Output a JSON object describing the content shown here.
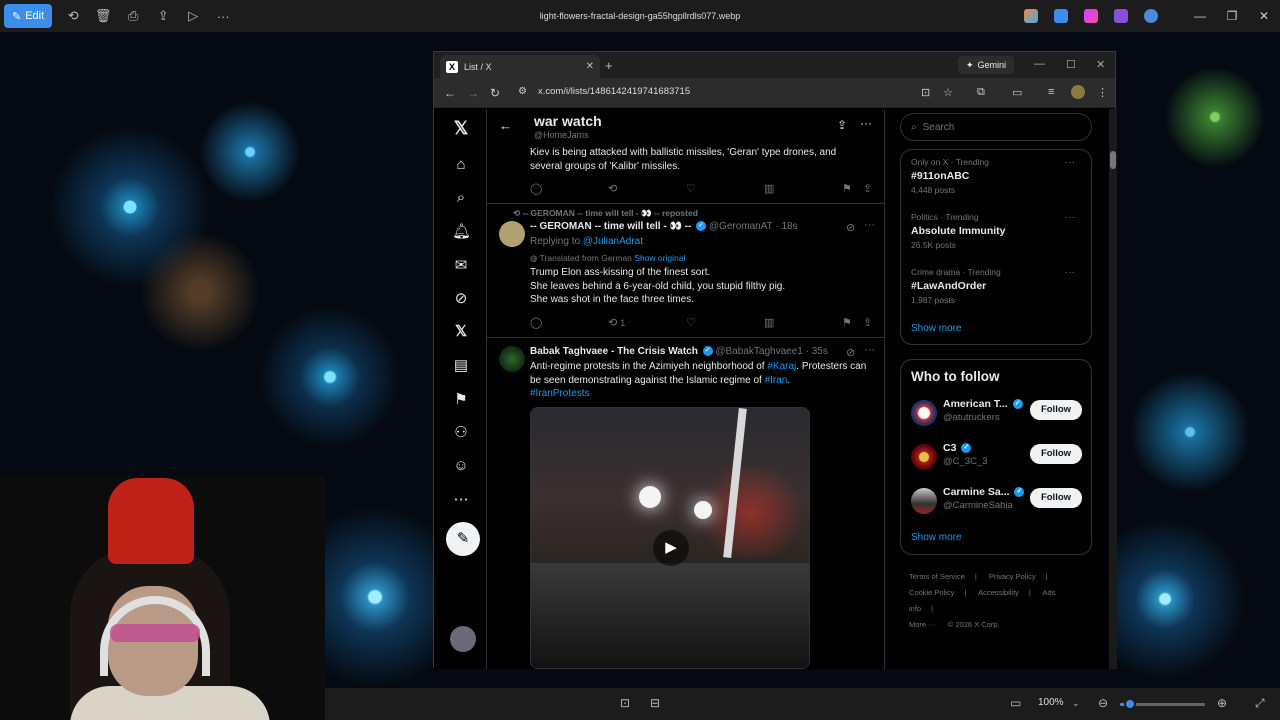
{
  "viewer": {
    "edit_label": "Edit",
    "filename": "light-flowers-fractal-design-ga55hgpllrdls077.webp",
    "zoom": "100%",
    "zoom_level": 0.12
  },
  "browser": {
    "tab_title": "List / X",
    "tab_logo": "X",
    "new_tab": "+",
    "gemini_label": "Gemini",
    "url": "x.com/i/lists/1486142419741683715"
  },
  "list": {
    "title": "war watch",
    "handle": "@HomeJams"
  },
  "tweets": [
    {
      "text": "Kiev is being attacked with ballistic missiles, 'Geran' type drones, and several groups of 'Kalibr' missiles.",
      "retweets": "",
      "likes": ""
    },
    {
      "repost_label": "-- GEROMAN -- time will tell - 👀 -- reposted",
      "name": "-- GEROMAN -- time will tell - 👀 --",
      "handle": "@GeromanAT",
      "time": "· 18s",
      "replying_to_prefix": "Replying to ",
      "replying_to": "@JulianAdrat",
      "translated": "Translated from German",
      "show_original": "Show original",
      "line1": "Trump Elon ass-kissing of the finest sort.",
      "line2": "She leaves behind a 6-year-old child, you stupid filthy pig.",
      "line3": "She was shot in the face three times.",
      "retweets": "1"
    },
    {
      "name": "Babak Taghvaee - The Crisis Watch",
      "handle": "@BabakTaghvaee1",
      "time": "· 35s",
      "text_a": "Anti-regime protests in the Azimiyeh neighborhood of ",
      "tag1": "#Karaj",
      "text_b": ". Protesters can be seen demonstrating against the Islamic regime of ",
      "tag2": "#Iran",
      "text_c": ".",
      "tag3": "#IranProtests"
    }
  ],
  "sidebar": {
    "search_placeholder": "Search",
    "trends": [
      {
        "meta": "Only on X · Trending",
        "name": "#911onABC",
        "count": "4,448 posts"
      },
      {
        "meta": "Politics · Trending",
        "name": "Absolute Immunity",
        "count": "26.5K posts"
      },
      {
        "meta": "Crime drama · Trending",
        "name": "#LawAndOrder",
        "count": "1,987 posts"
      }
    ],
    "show_more": "Show more",
    "who_to_follow": "Who to follow",
    "follow_label": "Follow",
    "suggestions": [
      {
        "name": "American T...",
        "handle": "@atutruckers"
      },
      {
        "name": "C3",
        "handle": "@C_3C_3"
      },
      {
        "name": "Carmine Sa...",
        "handle": "@CarmineSabia"
      }
    ],
    "footer": {
      "terms": "Terms of Service",
      "privacy": "Privacy Policy",
      "cookie": "Cookie Policy",
      "accessibility": "Accessibility",
      "ads": "Ads info",
      "more": "More ···",
      "copyright": "© 2026 X Corp."
    }
  }
}
